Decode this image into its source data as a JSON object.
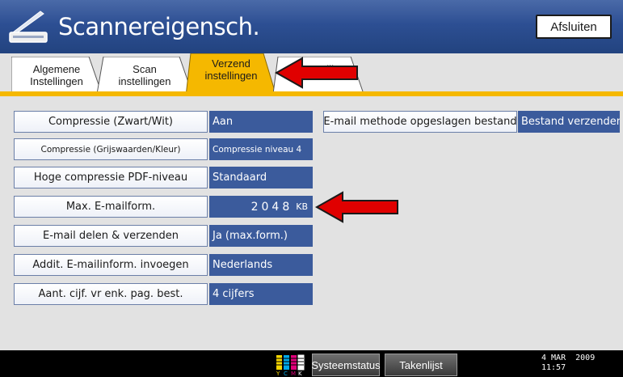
{
  "window": {
    "title": "Scannereigensch.",
    "close_label": "Afsluiten"
  },
  "tabs": [
    {
      "line1": "Algemene",
      "line2": "Instellingen",
      "active": false
    },
    {
      "line1": "Scan",
      "line2": "instellingen",
      "active": false
    },
    {
      "line1": "Verzend",
      "line2": "instellingen",
      "active": true
    },
    {
      "line1": "",
      "line2": "Instellingen",
      "active": false,
      "partially_obscured": true
    }
  ],
  "settings": [
    {
      "label": "Compressie (Zwart/Wit)",
      "value": "Aan"
    },
    {
      "label": "Compressie (Grijswaarden/Kleur)",
      "value": "Compressie niveau 4"
    },
    {
      "label": "Hoge compressie PDF-niveau",
      "value": "Standaard"
    },
    {
      "label": "Max. E-mailform.",
      "value": "2048",
      "unit": "KB"
    },
    {
      "label": "E-mail delen & verzenden",
      "value": "Ja (max.form.)"
    },
    {
      "label": "Addit. E-mailinform. invoegen",
      "value": "Nederlands"
    },
    {
      "label": "Aant. cijf. vr enk. pag. best.",
      "value": "4 cijfers"
    }
  ],
  "right_settings": [
    {
      "label": "E-mail methode opgeslagen bestand",
      "value": "Bestand verzenden"
    }
  ],
  "statusbar": {
    "ink_letters": "YCMK",
    "system_status_label": "Systeemstatus",
    "job_list_label": "Takenlijst",
    "date": "4 MAR  2009",
    "time": "11:57"
  },
  "colors": {
    "titlebar": "#2d4f93",
    "active_tab": "#f5b800",
    "value_box": "#3b5b9c",
    "annotation_arrow": "#e00000"
  },
  "icons": {
    "title": "scanner-icon",
    "annotation": "red-arrow-icon"
  }
}
